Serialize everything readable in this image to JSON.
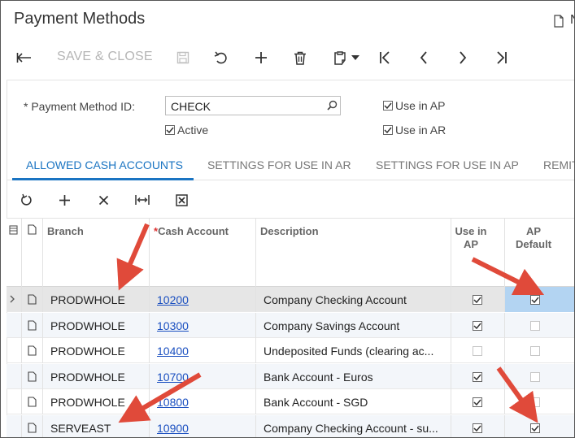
{
  "header": {
    "title": "Payment Methods",
    "top_right_text": "N"
  },
  "toolbar": {
    "save_close_label": "SAVE & CLOSE"
  },
  "form": {
    "payment_method_id_label": "Payment Method ID:",
    "required_mark": "*",
    "payment_method_id_value": "CHECK",
    "active_label": "Active",
    "use_in_ap_label": "Use in AP",
    "use_in_ar_label": "Use in AR"
  },
  "tabs": [
    {
      "label": "ALLOWED CASH ACCOUNTS",
      "active": true
    },
    {
      "label": "SETTINGS FOR USE IN AR"
    },
    {
      "label": "SETTINGS FOR USE IN AP"
    },
    {
      "label": "REMIT"
    }
  ],
  "grid": {
    "columns": {
      "branch": "Branch",
      "cash_account_req": "*",
      "cash_account": "Cash Account",
      "description": "Description",
      "use_in_ap_l1": "Use in",
      "use_in_ap_l2": "AP",
      "ap_default_l1": "AP",
      "ap_default_l2": "Default"
    },
    "rows": [
      {
        "branch": "PRODWHOLE",
        "account": "10200",
        "description": "Company Checking Account",
        "use_in_ap": true,
        "ap_default": true
      },
      {
        "branch": "PRODWHOLE",
        "account": "10300",
        "description": "Company Savings Account",
        "use_in_ap": true,
        "ap_default": false
      },
      {
        "branch": "PRODWHOLE",
        "account": "10400",
        "description": "Undeposited Funds (clearing ac...",
        "use_in_ap": false,
        "ap_default": false
      },
      {
        "branch": "PRODWHOLE",
        "account": "10700",
        "description": "Bank Account - Euros",
        "use_in_ap": true,
        "ap_default": false
      },
      {
        "branch": "PRODWHOLE",
        "account": "10800",
        "description": "Bank Account - SGD",
        "use_in_ap": true,
        "ap_default": false
      },
      {
        "branch": "SERVEAST",
        "account": "10900",
        "description": "Company Checking Account - su...",
        "use_in_ap": true,
        "ap_default": true
      }
    ]
  },
  "colors": {
    "accent": "#1a74c2",
    "annotation_arrow": "#e04a3a",
    "selected_cell": "#b3d4f2"
  }
}
